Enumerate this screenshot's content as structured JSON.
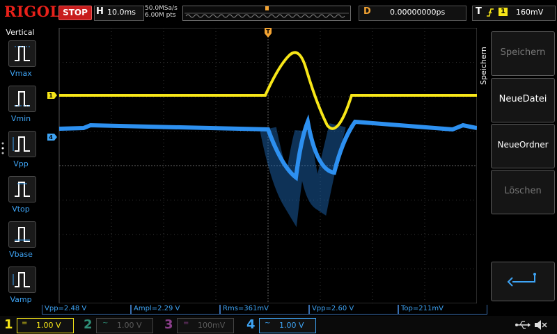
{
  "header": {
    "brand": "RIGOL",
    "run_state": "STOP",
    "timebase_letter": "H",
    "timebase": "10.0ms",
    "sample_rate": "50.0MSa/s",
    "memory_depth": "6.00M pts",
    "delay_letter": "D",
    "delay": "0.00000000ps",
    "trigger_letter": "T",
    "trigger_source": "1",
    "trigger_level": "160mV"
  },
  "left_panel": {
    "title": "Vertical",
    "items": [
      {
        "label": "Vmax"
      },
      {
        "label": "Vmin"
      },
      {
        "label": "Vpp"
      },
      {
        "label": "Vtop"
      },
      {
        "label": "Vbase"
      },
      {
        "label": "Vamp"
      }
    ]
  },
  "right_panel": {
    "title": "Speichern",
    "buttons": [
      {
        "label": "Speichern",
        "enabled": false
      },
      {
        "label": "NeueDatei",
        "enabled": true
      },
      {
        "label": "NeueOrdner",
        "enabled": true
      },
      {
        "label": "Löschen",
        "enabled": false
      }
    ],
    "return_icon": "return-arrow-icon"
  },
  "screen": {
    "trigger_marker": "T",
    "ch1_marker": "1",
    "ch4_marker": "4"
  },
  "measurements": [
    "Vpp=2.48 V",
    "Ampl=2.29 V",
    "Rms=361mV",
    "Vpp=2.60 V",
    "Top=211mV"
  ],
  "channels": [
    {
      "num": "1",
      "coupling_symbol": "=",
      "scale": "1.00 V",
      "color": "#f7e618",
      "active": true
    },
    {
      "num": "2",
      "coupling_symbol": "~",
      "scale": "1.00 V",
      "color": "#2f8f77",
      "active": false
    },
    {
      "num": "3",
      "coupling_symbol": "=",
      "scale": "100mV",
      "color": "#8a3d8a",
      "active": false
    },
    {
      "num": "4",
      "coupling_symbol": "~",
      "scale": "1.00 V",
      "color": "#3ea4f5",
      "active": true
    }
  ],
  "status_icons": [
    "usb-icon",
    "speaker-muted-icon"
  ],
  "colors": {
    "ch1": "#f7e618",
    "ch4": "#3ea4f5",
    "trigger": "#f3a332",
    "stop": "#c81d1d"
  }
}
